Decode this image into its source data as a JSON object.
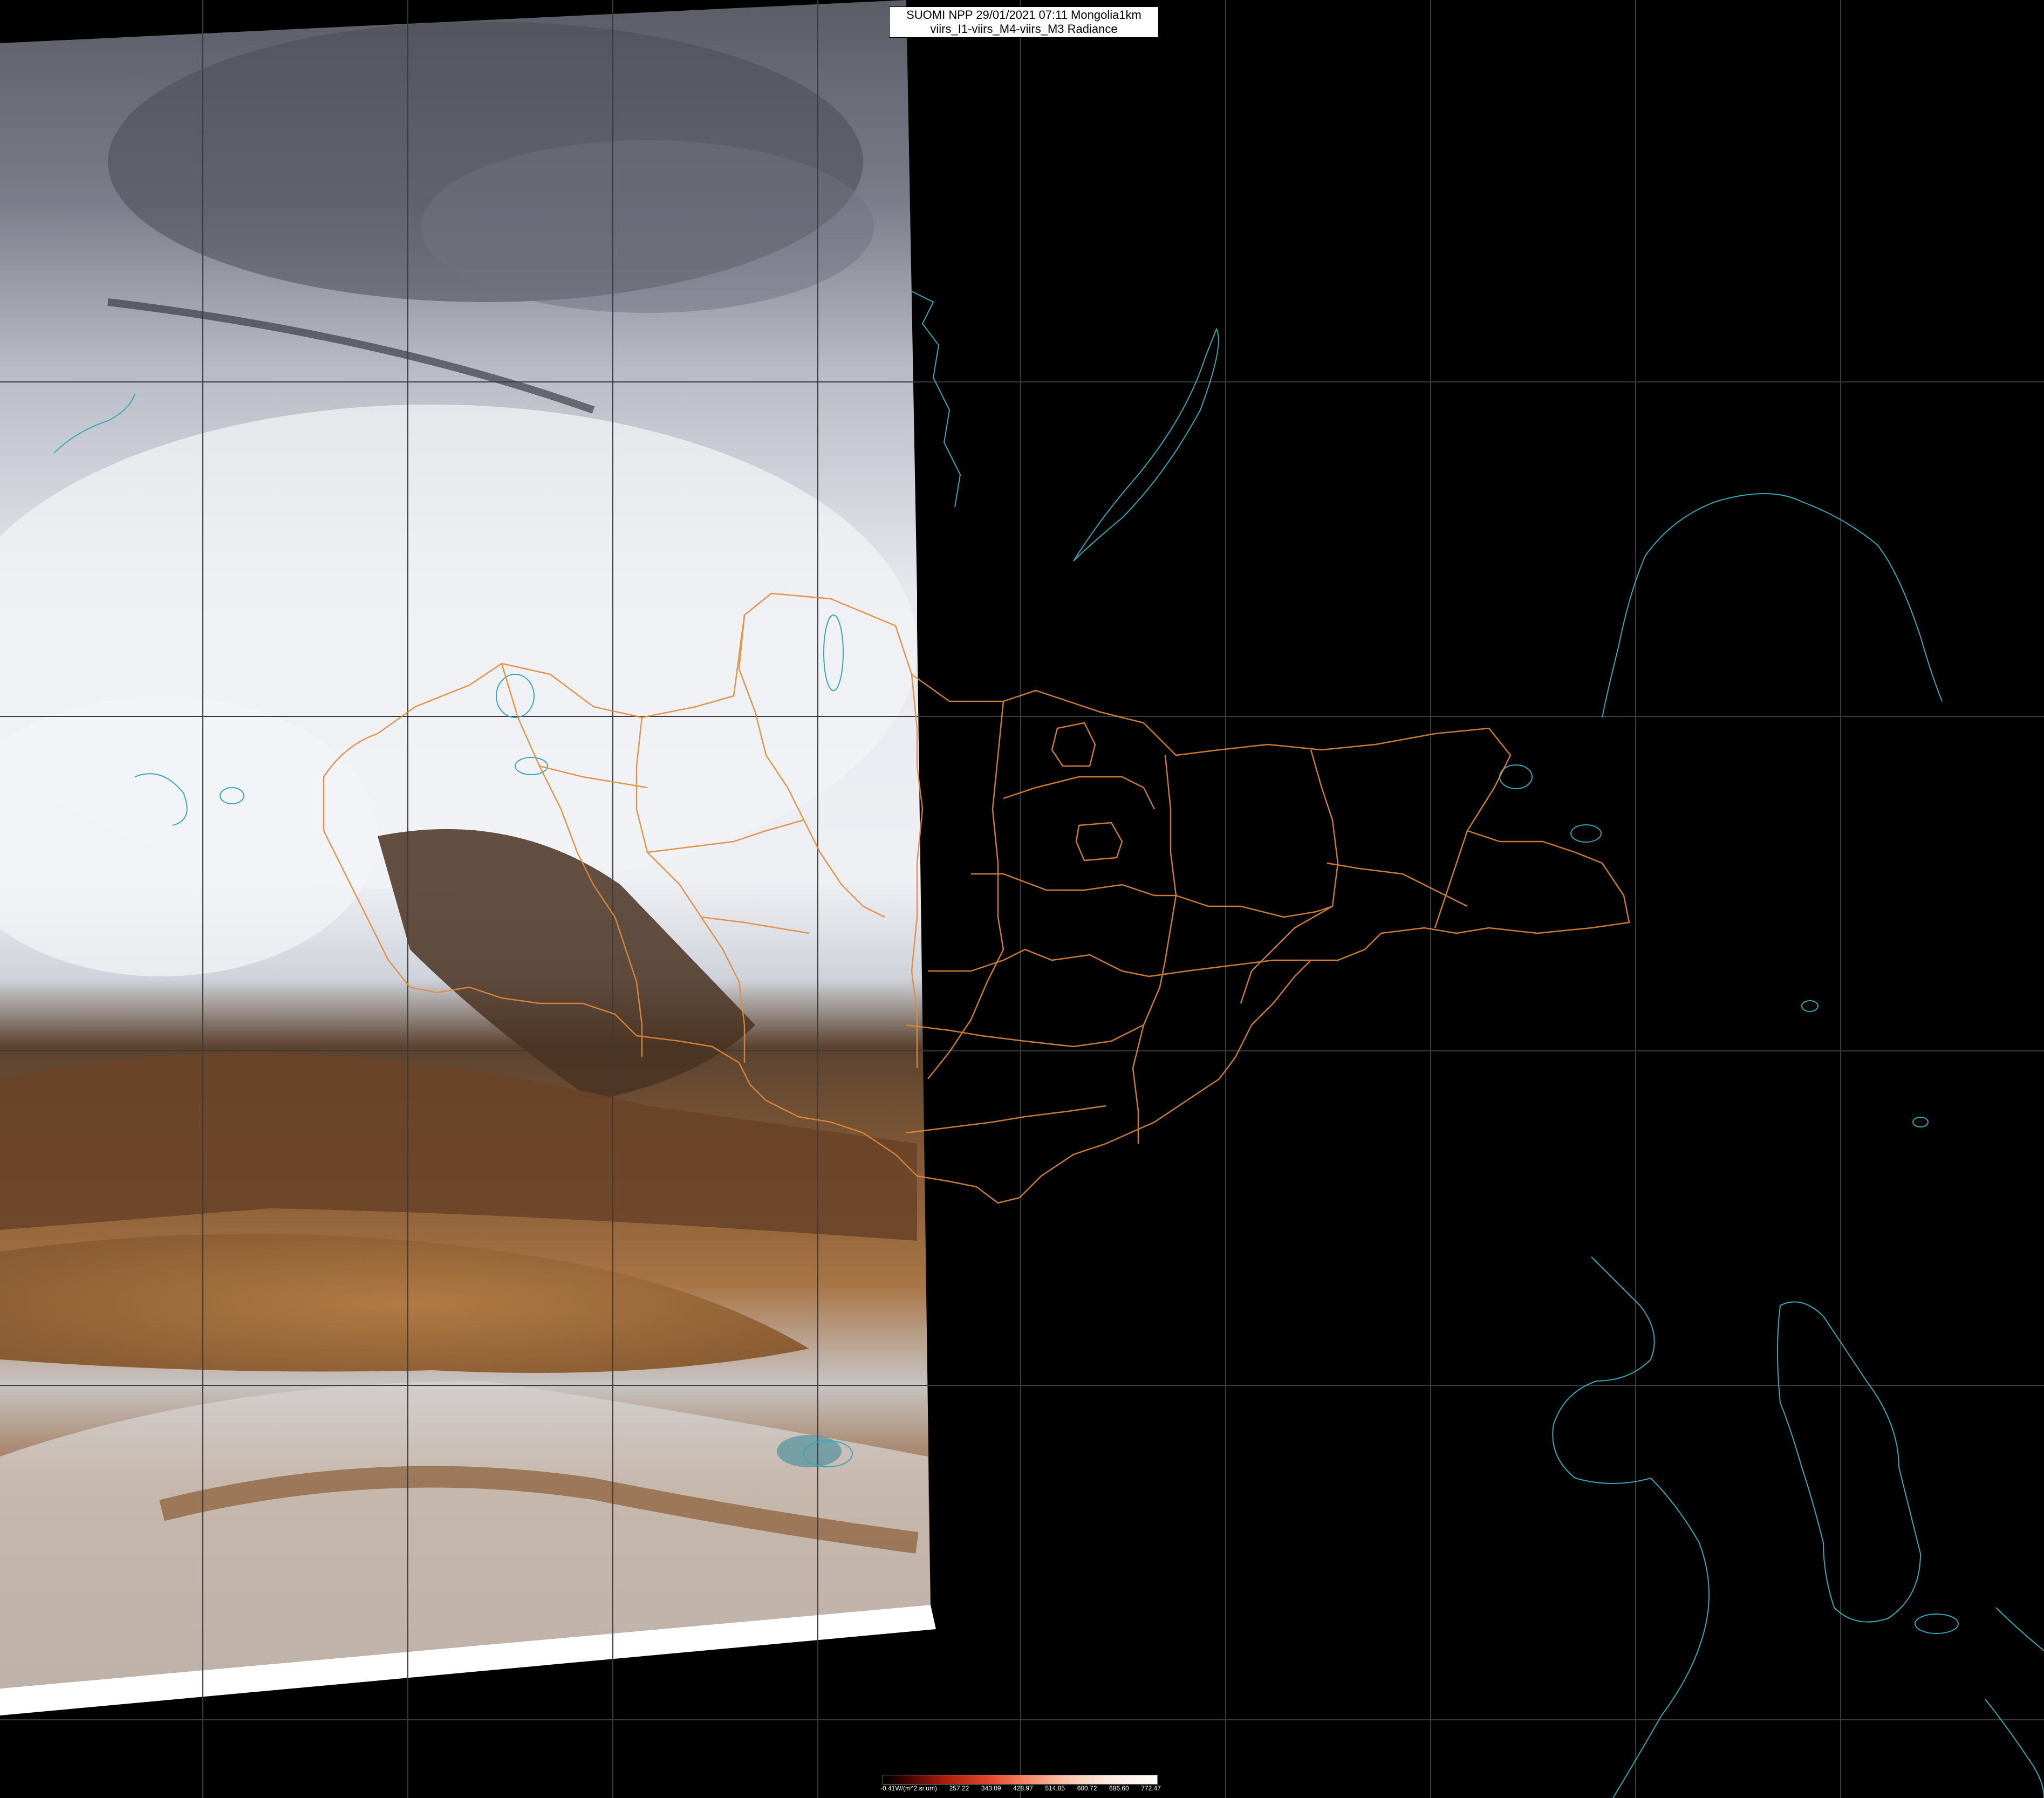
{
  "title": {
    "line1": "SUOMI NPP 29/01/2021 07:11 Mongolia1km",
    "line2": "viirs_I1-viirs_M4-viirs_M3 Radiance"
  },
  "legend": {
    "labels": [
      "-0.41W/(m^2.sr.um)",
      "257.22",
      "343.09",
      "428.97",
      "514.85",
      "600.72",
      "686.60",
      "772.47"
    ]
  },
  "colors": {
    "background": "#000000",
    "graticule": "#3a3a3a",
    "borders": "#e08a3a",
    "coastlines": "#3aa7b8",
    "cloud": "#e8eaf0",
    "desert": "#9c6a3a",
    "swath_edge": "#ffffff"
  }
}
